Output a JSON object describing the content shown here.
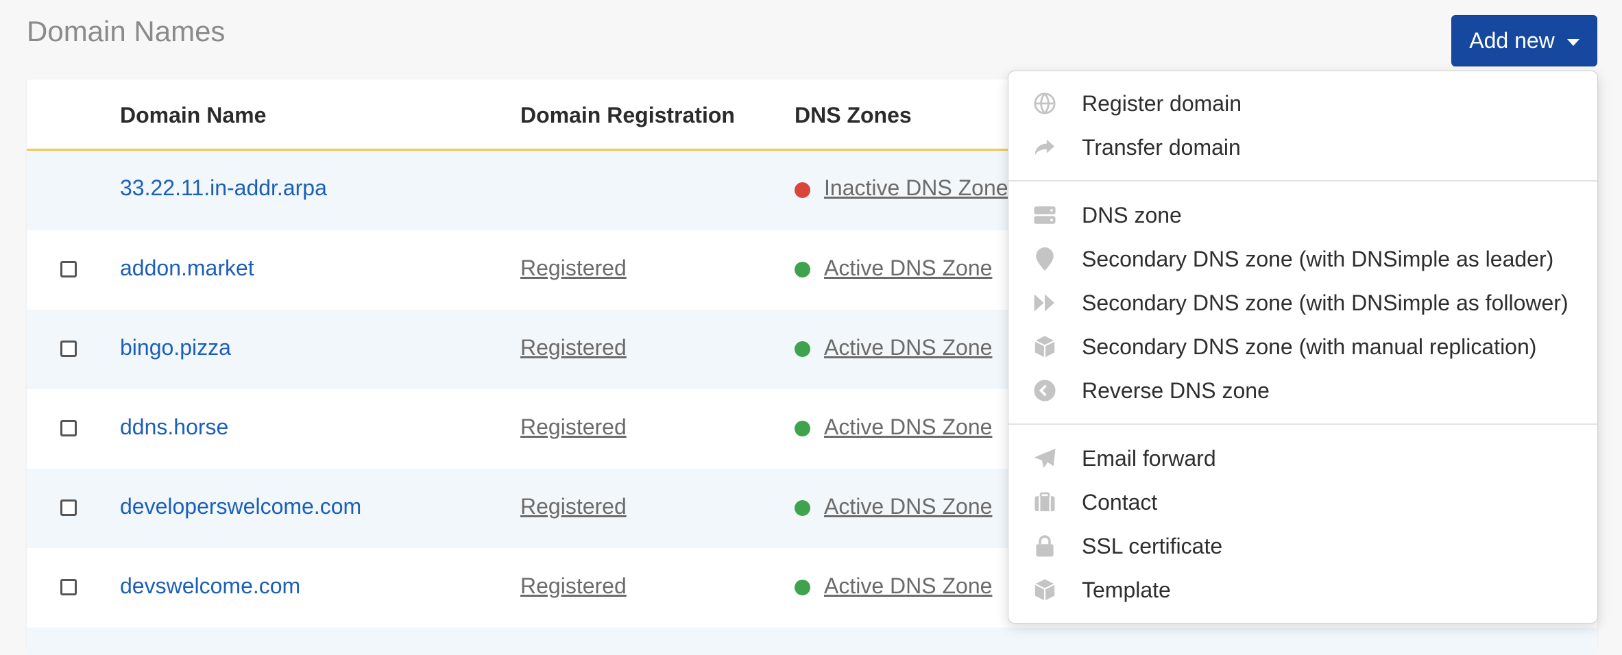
{
  "page": {
    "title": "Domain Names"
  },
  "add_button": {
    "label": "Add new"
  },
  "table": {
    "headers": {
      "domain_name": "Domain Name",
      "domain_registration": "Domain Registration",
      "dns_zones": "DNS Zones"
    },
    "rows": [
      {
        "domain": "33.22.11.in-addr.arpa",
        "registration": "",
        "dns_zone": "Inactive DNS Zone",
        "status": "inactive",
        "selectable": false
      },
      {
        "domain": "addon.market",
        "registration": "Registered",
        "dns_zone": "Active DNS Zone",
        "status": "active",
        "selectable": true
      },
      {
        "domain": "bingo.pizza",
        "registration": "Registered",
        "dns_zone": "Active DNS Zone",
        "status": "active",
        "selectable": true
      },
      {
        "domain": "ddns.horse",
        "registration": "Registered",
        "dns_zone": "Active DNS Zone",
        "status": "active",
        "selectable": true
      },
      {
        "domain": "developerswelcome.com",
        "registration": "Registered",
        "dns_zone": "Active DNS Zone",
        "status": "active",
        "selectable": true
      },
      {
        "domain": "devswelcome.com",
        "registration": "Registered",
        "dns_zone": "Active DNS Zone",
        "status": "active",
        "selectable": true
      }
    ]
  },
  "menu": {
    "items": [
      {
        "label": "Register domain",
        "icon": "globe-icon"
      },
      {
        "label": "Transfer domain",
        "icon": "share-icon"
      },
      {
        "label": "DNS zone",
        "icon": "server-icon"
      },
      {
        "label": "Secondary DNS zone (with DNSimple as leader)",
        "icon": "map-pin-icon"
      },
      {
        "label": "Secondary DNS zone (with DNSimple as follower)",
        "icon": "fast-forward-icon"
      },
      {
        "label": "Secondary DNS zone (with manual replication)",
        "icon": "cube-icon"
      },
      {
        "label": "Reverse DNS zone",
        "icon": "arrow-left-circle-icon"
      },
      {
        "label": "Email forward",
        "icon": "paper-plane-icon"
      },
      {
        "label": "Contact",
        "icon": "suitcase-icon"
      },
      {
        "label": "SSL certificate",
        "icon": "lock-icon"
      },
      {
        "label": "Template",
        "icon": "cube-icon"
      }
    ]
  },
  "colors": {
    "accent": "#1748a0",
    "link": "#1c5fb8",
    "active_dot": "#3fa34d",
    "inactive_dot": "#d9443b",
    "header_border": "#f2c94c",
    "icon": "#c4c4c4"
  }
}
